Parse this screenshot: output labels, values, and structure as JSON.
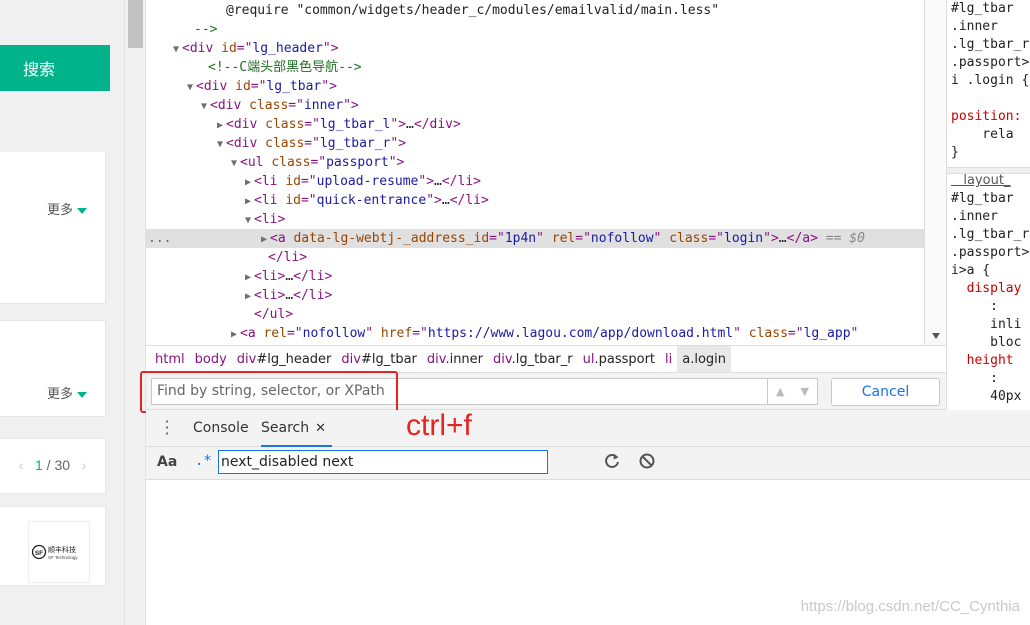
{
  "webpage": {
    "search_button": "搜索",
    "more_label_1": "更多",
    "more_label_2": "更多",
    "pager": {
      "prev": "‹",
      "current": "1",
      "sep": " / ",
      "total": "30",
      "next": "›"
    },
    "logo_cn": "顺丰科技",
    "logo_en": "SF Technology",
    "logo_mark": "SF"
  },
  "elements": {
    "lines": [
      {
        "indent": 80,
        "arrow": "",
        "parts": [
          [
            "txt",
            "@require \"common/widgets/header_c/modules/emailvalid/main.less\""
          ]
        ]
      },
      {
        "indent": 48,
        "arrow": "",
        "parts": [
          [
            "cm",
            "-->"
          ]
        ]
      },
      {
        "indent": 36,
        "arrow": "▼",
        "parts": [
          [
            "tag",
            "<div "
          ],
          [
            "an",
            "id"
          ],
          [
            "tag",
            "=\""
          ],
          [
            "av",
            "lg_header"
          ],
          [
            "tag",
            "\">"
          ]
        ]
      },
      {
        "indent": 62,
        "arrow": "",
        "parts": [
          [
            "cm",
            "<!--C端头部黑色导航-->"
          ]
        ]
      },
      {
        "indent": 50,
        "arrow": "▼",
        "parts": [
          [
            "tag",
            "<div "
          ],
          [
            "an",
            "id"
          ],
          [
            "tag",
            "=\""
          ],
          [
            "av",
            "lg_tbar"
          ],
          [
            "tag",
            "\">"
          ]
        ]
      },
      {
        "indent": 64,
        "arrow": "▼",
        "parts": [
          [
            "tag",
            "<div "
          ],
          [
            "an",
            "class"
          ],
          [
            "tag",
            "=\""
          ],
          [
            "av",
            "inner"
          ],
          [
            "tag",
            "\">"
          ]
        ]
      },
      {
        "indent": 80,
        "arrow": "▶",
        "parts": [
          [
            "tag",
            "<div "
          ],
          [
            "an",
            "class"
          ],
          [
            "tag",
            "=\""
          ],
          [
            "av",
            "lg_tbar_l"
          ],
          [
            "tag",
            "\">"
          ],
          [
            "txt",
            "…"
          ],
          [
            "tag",
            "</div>"
          ]
        ]
      },
      {
        "indent": 80,
        "arrow": "▼",
        "parts": [
          [
            "tag",
            "<div "
          ],
          [
            "an",
            "class"
          ],
          [
            "tag",
            "=\""
          ],
          [
            "av",
            "lg_tbar_r"
          ],
          [
            "tag",
            "\">"
          ]
        ]
      },
      {
        "indent": 94,
        "arrow": "▼",
        "parts": [
          [
            "tag",
            "<ul "
          ],
          [
            "an",
            "class"
          ],
          [
            "tag",
            "=\""
          ],
          [
            "av",
            "passport"
          ],
          [
            "tag",
            "\">"
          ]
        ]
      },
      {
        "indent": 108,
        "arrow": "▶",
        "parts": [
          [
            "tag",
            "<li "
          ],
          [
            "an",
            "id"
          ],
          [
            "tag",
            "=\""
          ],
          [
            "av",
            "upload-resume"
          ],
          [
            "tag",
            "\">"
          ],
          [
            "txt",
            "…"
          ],
          [
            "tag",
            "</li>"
          ]
        ]
      },
      {
        "indent": 108,
        "arrow": "▶",
        "parts": [
          [
            "tag",
            "<li "
          ],
          [
            "an",
            "id"
          ],
          [
            "tag",
            "=\""
          ],
          [
            "av",
            "quick-entrance"
          ],
          [
            "tag",
            "\">"
          ],
          [
            "txt",
            "…"
          ],
          [
            "tag",
            "</li>"
          ]
        ]
      },
      {
        "indent": 108,
        "arrow": "▼",
        "parts": [
          [
            "tag",
            "<li>"
          ]
        ]
      },
      {
        "indent": 124,
        "arrow": "▶",
        "sel": true,
        "parts": [
          [
            "tag",
            "<a "
          ],
          [
            "an",
            "data-lg-webtj-_address_id"
          ],
          [
            "tag",
            "=\""
          ],
          [
            "av",
            "1p4n"
          ],
          [
            "tag",
            "\" "
          ],
          [
            "an",
            "rel"
          ],
          [
            "tag",
            "=\""
          ],
          [
            "av",
            "nofollow"
          ],
          [
            "tag",
            "\" "
          ],
          [
            "an",
            "class"
          ],
          [
            "tag",
            "=\""
          ],
          [
            "av",
            "login"
          ],
          [
            "tag",
            "\">"
          ],
          [
            "txt",
            "…"
          ],
          [
            "tag",
            "</a>"
          ],
          [
            "dim",
            " == $0"
          ]
        ]
      },
      {
        "indent": 122,
        "arrow": "",
        "parts": [
          [
            "tag",
            "</li>"
          ]
        ]
      },
      {
        "indent": 108,
        "arrow": "▶",
        "parts": [
          [
            "tag",
            "<li>"
          ],
          [
            "txt",
            "…"
          ],
          [
            "tag",
            "</li>"
          ]
        ]
      },
      {
        "indent": 108,
        "arrow": "▶",
        "parts": [
          [
            "tag",
            "<li>"
          ],
          [
            "txt",
            "…"
          ],
          [
            "tag",
            "</li>"
          ]
        ]
      },
      {
        "indent": 108,
        "arrow": "",
        "parts": [
          [
            "tag",
            "</ul>"
          ]
        ]
      },
      {
        "indent": 94,
        "arrow": "▶",
        "parts": [
          [
            "tag",
            "<a "
          ],
          [
            "an",
            "rel"
          ],
          [
            "tag",
            "=\""
          ],
          [
            "av",
            "nofollow"
          ],
          [
            "tag",
            "\" "
          ],
          [
            "an",
            "href"
          ],
          [
            "tag",
            "=\""
          ],
          [
            "av",
            "https://www.lagou.com/app/download.html"
          ],
          [
            "tag",
            "\" "
          ],
          [
            "an",
            "class"
          ],
          [
            "tag",
            "=\""
          ],
          [
            "av",
            "lg_app"
          ],
          [
            "tag",
            "\""
          ]
        ]
      }
    ],
    "ellipsis": "..."
  },
  "breadcrumb": [
    {
      "tag": "html",
      "rest": "",
      "active": false
    },
    {
      "tag": "body",
      "rest": "",
      "active": false
    },
    {
      "tag": "div",
      "rest": "#lg_header",
      "active": false
    },
    {
      "tag": "div",
      "rest": "#lg_tbar",
      "active": false
    },
    {
      "tag": "div",
      "rest": ".inner",
      "active": false
    },
    {
      "tag": "div",
      "rest": ".lg_tbar_r",
      "active": false
    },
    {
      "tag": "ul",
      "rest": ".passport",
      "active": false
    },
    {
      "tag": "li",
      "rest": "",
      "active": false
    },
    {
      "tag": "a",
      "rest": ".login",
      "active": true
    }
  ],
  "findbar": {
    "placeholder": "Find by string, selector, or XPath",
    "cancel": "Cancel",
    "up": "▲",
    "down": "▼"
  },
  "styles": {
    "lines": [
      {
        "text": "#lg_tbar",
        "kind": ""
      },
      {
        "text": ".inner",
        "kind": ""
      },
      {
        "text": ".lg_tbar_r",
        "kind": ""
      },
      {
        "text": ".passport>",
        "kind": ""
      },
      {
        "text": "i .login {",
        "kind": ""
      },
      {
        "text": "",
        "kind": ""
      },
      {
        "text": "position:",
        "kind": "prop"
      },
      {
        "text": "    rela",
        "kind": ""
      },
      {
        "text": "}",
        "kind": ""
      }
    ],
    "lines2": [
      {
        "text": "   layout_",
        "kind": "link"
      },
      {
        "text": "#lg_tbar",
        "kind": ""
      },
      {
        "text": ".inner",
        "kind": ""
      },
      {
        "text": ".lg_tbar_r",
        "kind": ""
      },
      {
        "text": ".passport>",
        "kind": ""
      },
      {
        "text": "i>a {",
        "kind": ""
      },
      {
        "text": "  display",
        "kind": "prop"
      },
      {
        "text": "     :",
        "kind": ""
      },
      {
        "text": "     inli",
        "kind": ""
      },
      {
        "text": "     bloc",
        "kind": ""
      },
      {
        "text": "  height",
        "kind": "prop"
      },
      {
        "text": "     :",
        "kind": ""
      },
      {
        "text": "     40px",
        "kind": ""
      }
    ]
  },
  "drawer": {
    "menu": "⋮",
    "tabs": [
      {
        "label": "Console"
      },
      {
        "label": "Search"
      }
    ],
    "close": "✕"
  },
  "annotation": "ctrl+f",
  "search": {
    "case_label": "Aa",
    "regex_label": ".*",
    "query": "next_disabled next"
  },
  "watermark": "https://blog.csdn.net/CC_Cynthia",
  "colors": {
    "brand_green": "#00b38a",
    "annotation_red": "#e52424",
    "link_blue": "#1a73e8"
  }
}
